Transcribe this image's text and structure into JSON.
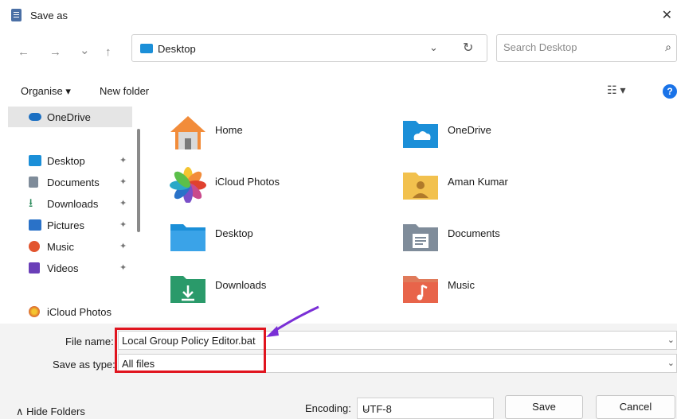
{
  "window": {
    "title": "Save as",
    "close_glyph": "✕"
  },
  "nav": {
    "back_glyph": "←",
    "forward_glyph": "→",
    "recent_glyph": "⌄",
    "up_glyph": "↑",
    "address_path": "Desktop",
    "address_dropdown_glyph": "⌄",
    "refresh_glyph": "↻",
    "search_placeholder": "Search Desktop",
    "search_glyph": "⌕"
  },
  "toolbar": {
    "organise_label": "Organise ▾",
    "new_folder_label": "New folder",
    "view_glyph": "☷ ▾",
    "help_glyph": "?"
  },
  "sidebar": {
    "items": [
      {
        "label": "OneDrive",
        "icon": "cloud-icon",
        "color": "#1b6fc2",
        "pinned": false,
        "selected": true
      },
      {
        "label": "Desktop",
        "icon": "desktop-folder-icon",
        "color": "#1b8fd8",
        "pinned": true
      },
      {
        "label": "Documents",
        "icon": "documents-icon",
        "color": "#7f8c9a",
        "pinned": true
      },
      {
        "label": "Downloads",
        "icon": "download-icon",
        "color": "#2a8a5a",
        "pinned": true
      },
      {
        "label": "Pictures",
        "icon": "pictures-icon",
        "color": "#2a72c8",
        "pinned": true
      },
      {
        "label": "Music",
        "icon": "music-icon",
        "color": "#e2552f",
        "pinned": true
      },
      {
        "label": "Videos",
        "icon": "videos-icon",
        "color": "#6a3fb8",
        "pinned": true
      },
      {
        "label": "iCloud Photos",
        "icon": "icloud-photos-icon",
        "color": "#e07a2a",
        "pinned": false
      }
    ],
    "pin_glyph": "📌"
  },
  "content": {
    "tiles": [
      {
        "name": "Home",
        "icon": "home-icon"
      },
      {
        "name": "OneDrive",
        "icon": "onedrive-folder-icon"
      },
      {
        "name": "iCloud Photos",
        "icon": "icloud-photos-icon"
      },
      {
        "name": "Aman Kumar",
        "icon": "user-folder-icon"
      },
      {
        "name": "Desktop",
        "icon": "desktop-folder-icon"
      },
      {
        "name": "Documents",
        "icon": "documents-folder-icon"
      },
      {
        "name": "Downloads",
        "icon": "downloads-folder-icon"
      },
      {
        "name": "Music",
        "icon": "music-folder-icon"
      }
    ]
  },
  "file": {
    "name_label": "File name:",
    "name_value": "Local Group Policy Editor.bat",
    "type_label": "Save as type:",
    "type_value": "All files",
    "dropdown_glyph": "⌄"
  },
  "footer": {
    "hide_folders_label": "Hide Folders",
    "hide_folders_glyph": "∧",
    "encoding_label": "Encoding:",
    "encoding_value": "UTF-8",
    "save_label": "Save",
    "cancel_label": "Cancel"
  },
  "colors": {
    "highlight": "#e0141e",
    "arrow": "#7a2fd6",
    "accent": "#1a73e8"
  }
}
